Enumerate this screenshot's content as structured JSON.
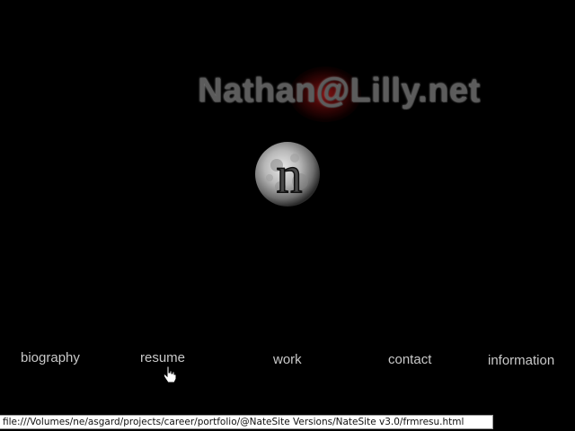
{
  "site": {
    "title": "Nathan@Lilly.net",
    "logo_letter": "n",
    "accent_glow": "#8c1010"
  },
  "nav": {
    "items": [
      {
        "label": "biography"
      },
      {
        "label": "resume"
      },
      {
        "label": "work"
      },
      {
        "label": "contact"
      },
      {
        "label": "information"
      }
    ]
  },
  "status_bar": {
    "url": "file:///Volumes/ne/asgard/projects/career/portfolio/@NateSite Versions/NateSite v3.0/frmresu.html"
  },
  "icons": {
    "cursor": "hand-pointer-icon",
    "logo": "moon-logo-icon"
  }
}
